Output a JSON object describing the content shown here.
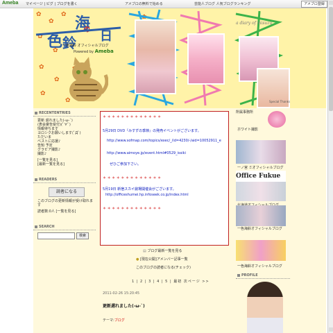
{
  "topbar": {
    "logo": "Ameba",
    "nav": "マイページ | ピグ | ブログを書く",
    "notice": "アメブロの無料で始める",
    "links": "芸能人ブログ 人気ブログランキング",
    "signup_button": "アメブロ登録"
  },
  "header": {
    "title_chars": [
      "海",
      "の",
      "日",
      "色",
      "鈴"
    ],
    "subtitle": "一色海鈴 オフィシャルブログ",
    "powered_by": "Powered by",
    "powered_brand": "Ameba",
    "diary": "a diary of misuzu",
    "special_thanks": "Special Thanks"
  },
  "left": {
    "recent_title": "RECENTENTRIES",
    "entries": [
      "更新 遅れました(-ω-`)",
      "(表会宴告受付)(ﾟ∀ﾟ)",
      "情報待ちます",
      "ヨロシクお願いします(ﾟДﾟ)",
      "ただいま",
      "ベストに応援♪",
      "告知 予定",
      "グラビア撮影♪",
      "撮影♪"
    ],
    "list_all": "[一覧を見る]",
    "list_recent": "[最新一覧を見る]",
    "readers_title": "READERS",
    "reader_button": "読者になる",
    "reader_note": "このブログの更新情報が受け取れます",
    "reader_count": "読者数:0人 [一覧を見る]",
    "search_title": "SEARCH",
    "search_button": "検索"
  },
  "notice": {
    "stars": "＊ ＊ ＊ ＊ ＊ ＊ ＊ ＊ ＊ ＊ ＊ ＊ ＊",
    "p1": "5月29日 DVD『みすずの季節』の発売イベントがございます。",
    "url1": "http://www.sofmap.com/topics/exec/_/id=4230/-/aid=10052911_e",
    "url2": "http://www.aimoye.jp/event.html#0529_issiki",
    "p1end": "ぜひご参加下さい。",
    "p2": "5月19日 新宿スカイ劇場開催会がございます。",
    "url3": "http://officeshumei.hp.infoseek.co.jp/index.html"
  },
  "center": {
    "link1": "ブログ最新一覧を見る",
    "link2": "[現在公開]アメンバー記事一覧",
    "link3": "このブログの読者になる(チェック)",
    "pager": "1 | 2 | 3 | 4 | 5 | 最初 次ページ >>",
    "date": "2011-02-26 15:20:45",
    "entry_title": "更新遅れました(-ω-`)",
    "theme_label": "テーマ:",
    "theme": "ブログ"
  },
  "right": {
    "affiliation": "所属事務所",
    "company": "ホワイト撮影",
    "blog1": "一ノ宮 ミオフィシャルブログ",
    "office": "Office Fukue",
    "blog2": "北海道オフィシャルブログ",
    "blog3": "一色海鈴オフィシャルブログ",
    "blog4": "一色海鈴オフィシャルブログ",
    "profile": "PROFILE"
  },
  "colors": {
    "header_bg": "#fff3a8",
    "page_bg": "#fff9dc",
    "title_blue": "#2c5da8",
    "notice_red": "#d01010",
    "notice_blue": "#1020c0"
  }
}
